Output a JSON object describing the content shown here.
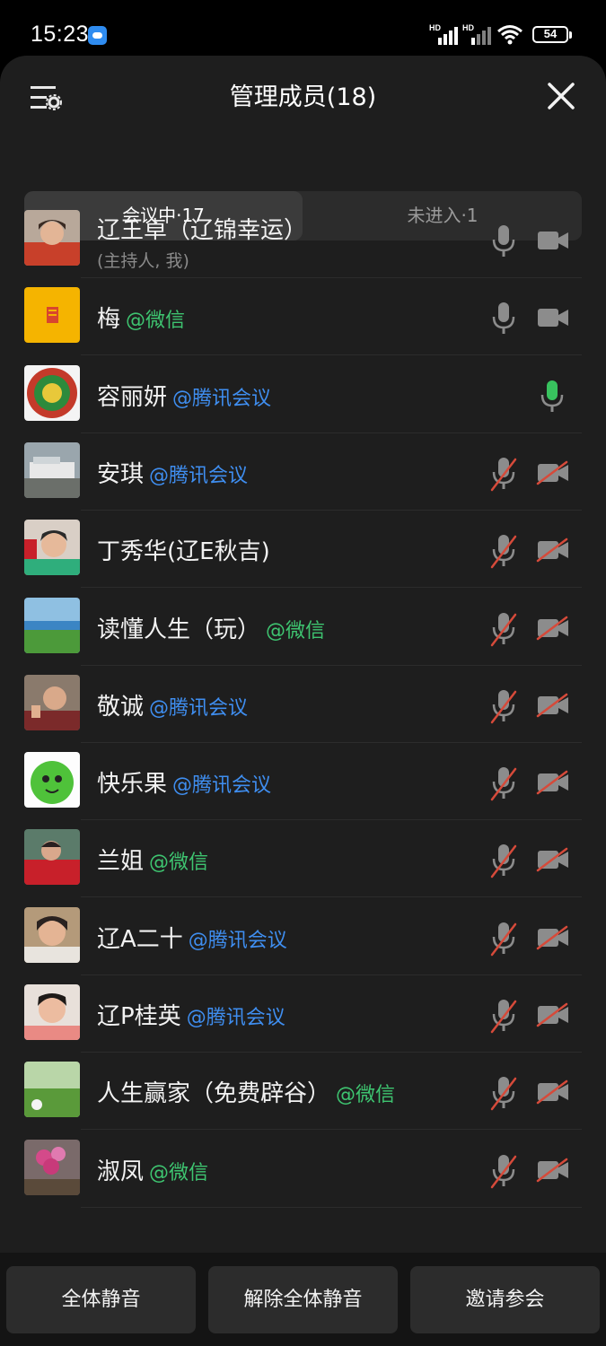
{
  "status": {
    "time": "15:23",
    "signal1_label": "HD",
    "signal2_label": "HD",
    "battery": "54"
  },
  "header": {
    "title": "管理成员(18)"
  },
  "tabs": [
    {
      "label": "会议中·17",
      "active": true
    },
    {
      "label": "未进入·1",
      "active": false
    }
  ],
  "members": [
    {
      "name": "辽王卓（辽锦幸运）",
      "tag": "",
      "subtitle": "(主持人, 我)",
      "mic": "on",
      "cam": "on",
      "avatar": "person-red"
    },
    {
      "name": "梅",
      "tag": "@微信",
      "tag_type": "wx",
      "mic": "on",
      "cam": "on",
      "avatar": "yellow-logo"
    },
    {
      "name": "容丽妍",
      "tag": "@腾讯会议",
      "tag_type": "tx",
      "mic": "speaking",
      "cam": "none",
      "avatar": "dragon"
    },
    {
      "name": "安琪",
      "tag": "@腾讯会议",
      "tag_type": "tx",
      "mic": "off",
      "cam": "off",
      "avatar": "ship"
    },
    {
      "name": "丁秀华(辽E秋吉)",
      "tag": "",
      "mic": "off",
      "cam": "off",
      "avatar": "person-green"
    },
    {
      "name": "读懂人生（玩）",
      "tag": "@微信",
      "tag_type": "wx",
      "mic": "off",
      "cam": "off",
      "avatar": "landscape"
    },
    {
      "name": "敬诚",
      "tag": "@腾讯会议",
      "tag_type": "tx",
      "mic": "off",
      "cam": "off",
      "avatar": "person-man"
    },
    {
      "name": "快乐果",
      "tag": "@腾讯会议",
      "tag_type": "tx",
      "mic": "off",
      "cam": "off",
      "avatar": "green-fruit"
    },
    {
      "name": "兰姐",
      "tag": "@微信",
      "tag_type": "wx",
      "mic": "off",
      "cam": "off",
      "avatar": "person-red2"
    },
    {
      "name": "辽A二十",
      "tag": "@腾讯会议",
      "tag_type": "tx",
      "mic": "off",
      "cam": "off",
      "avatar": "person-woman"
    },
    {
      "name": "辽P桂英",
      "tag": "@腾讯会议",
      "tag_type": "tx",
      "mic": "off",
      "cam": "off",
      "avatar": "person-woman2"
    },
    {
      "name": "人生赢家（免费辟谷）",
      "tag": "@微信",
      "tag_type": "wx",
      "mic": "off",
      "cam": "off",
      "avatar": "meadow"
    },
    {
      "name": "淑凤",
      "tag": "@微信",
      "tag_type": "wx",
      "mic": "off",
      "cam": "off",
      "avatar": "flowers"
    }
  ],
  "footer": {
    "mute_all": "全体静音",
    "unmute_all": "解除全体静音",
    "invite": "邀请参会"
  }
}
